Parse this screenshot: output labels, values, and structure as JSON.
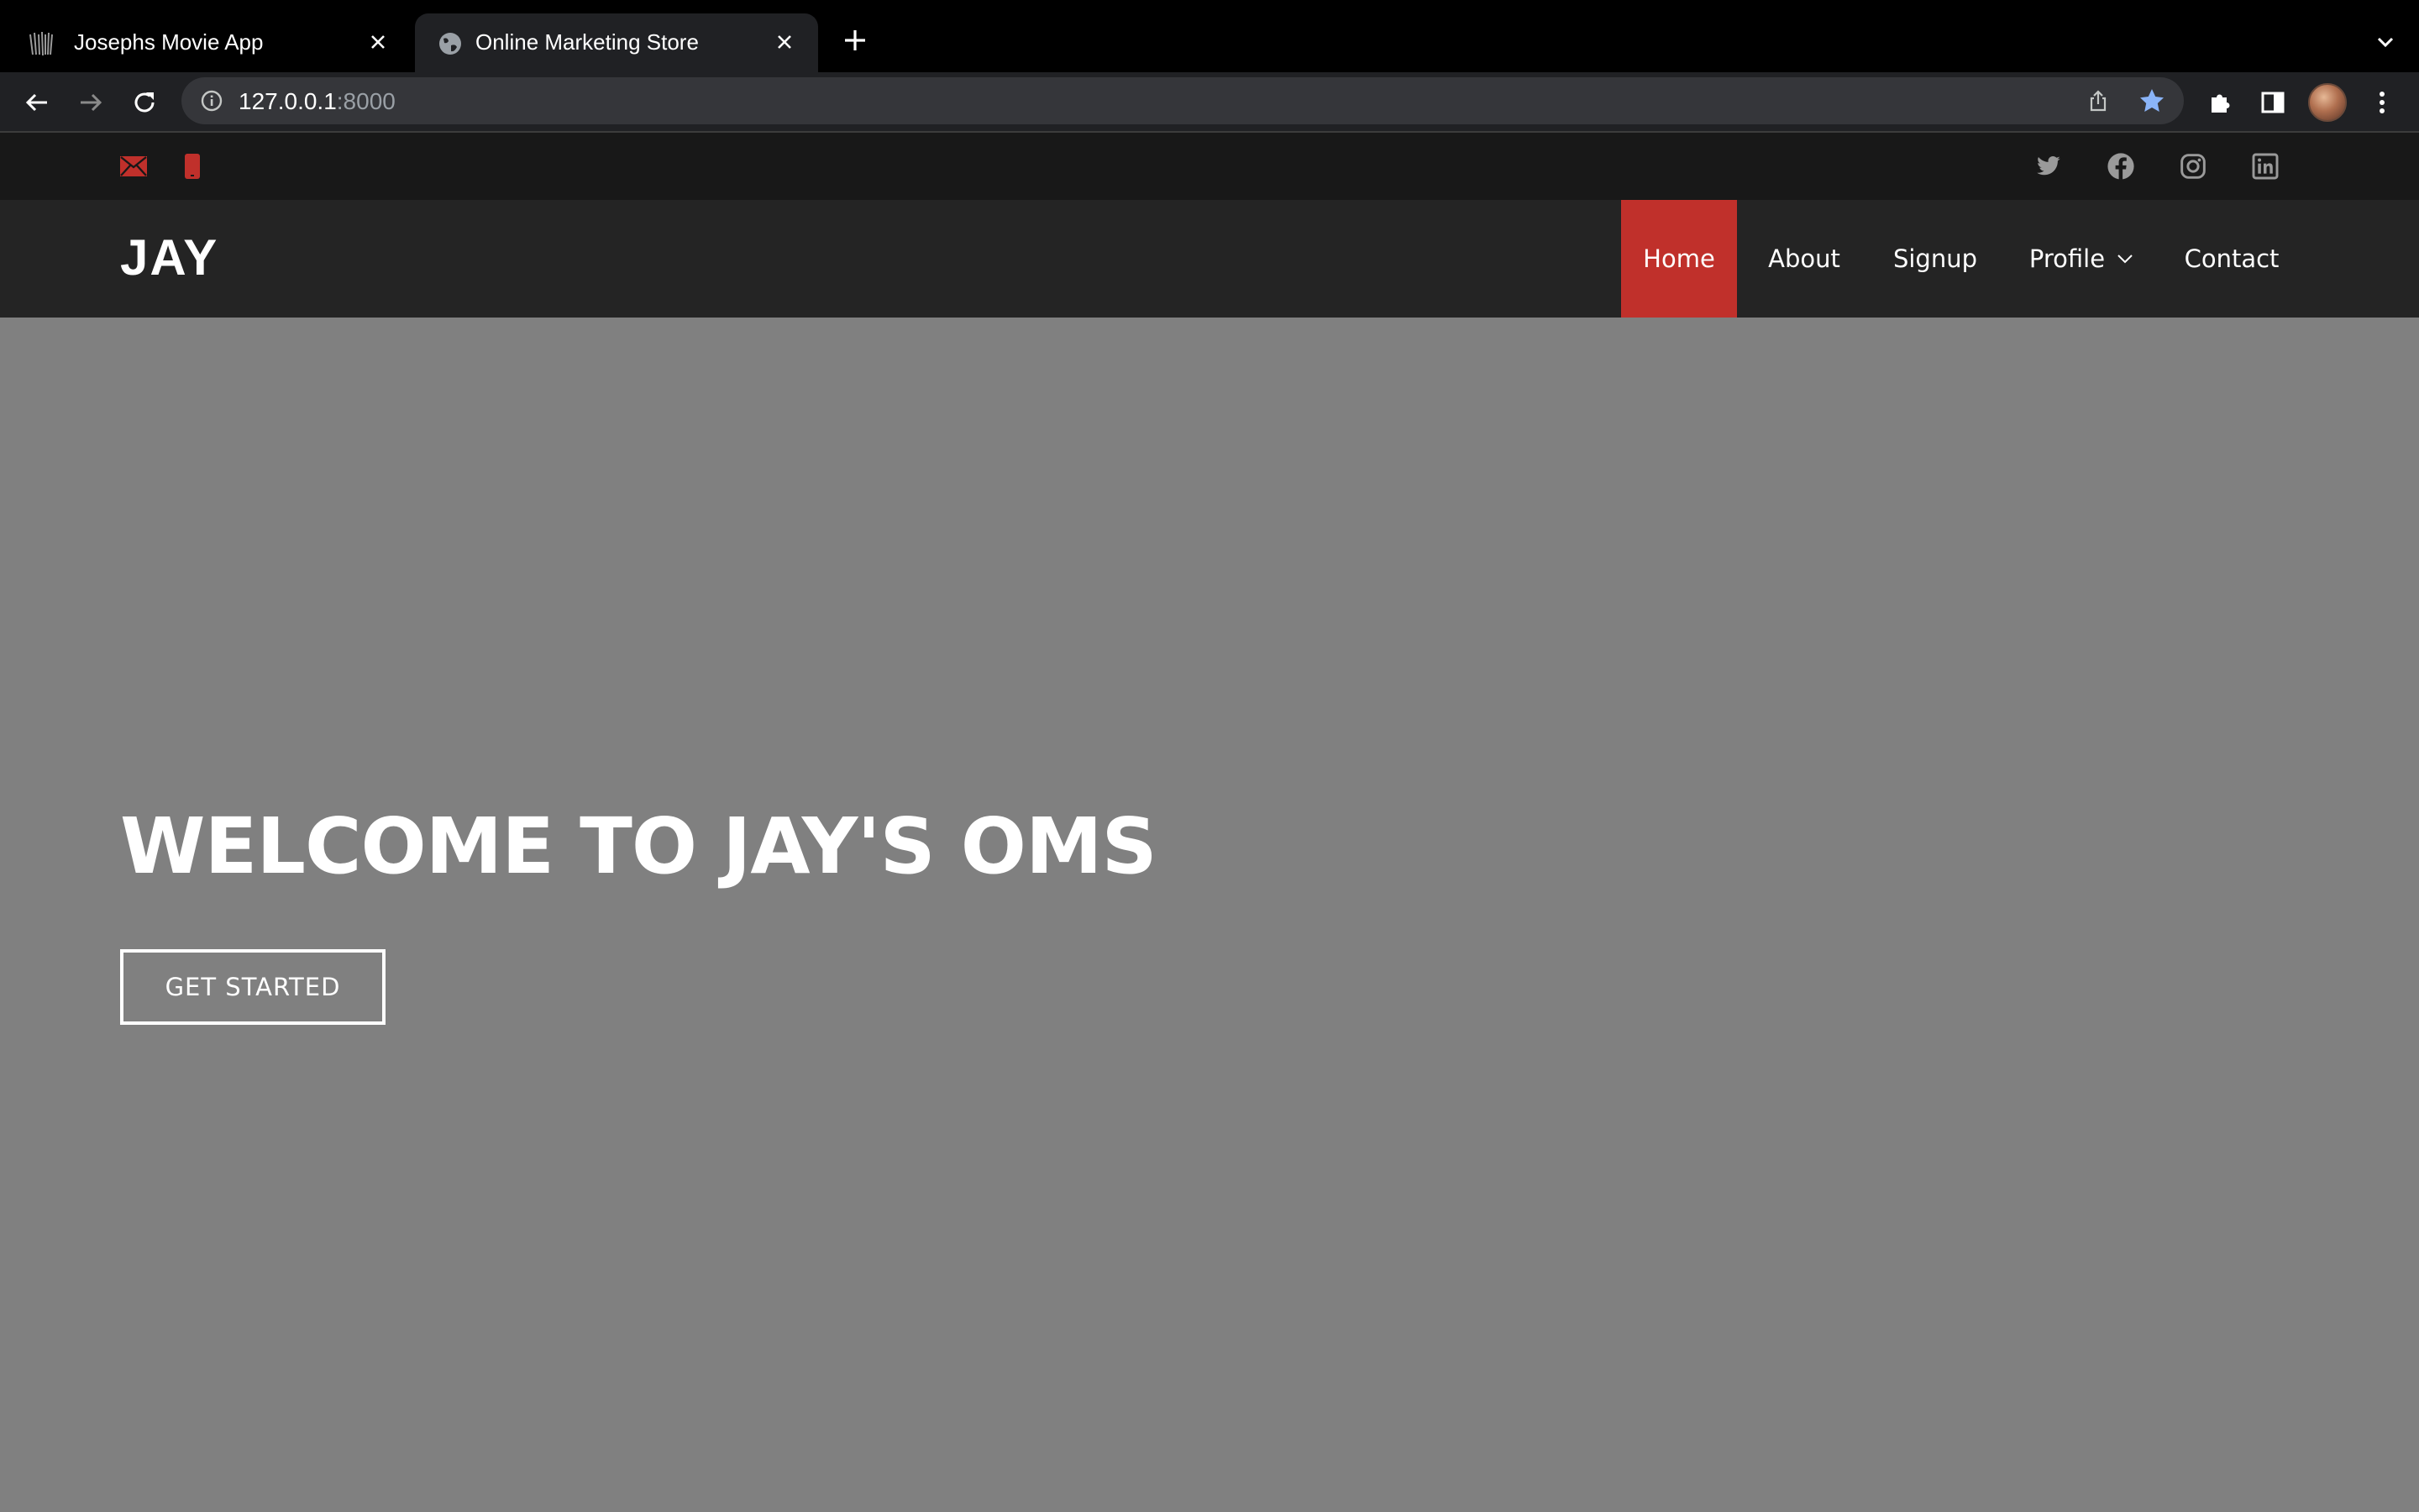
{
  "browser": {
    "tabs": [
      {
        "title": "Josephs Movie App",
        "active": false,
        "favicon": "movie-app-favicon-icon"
      },
      {
        "title": "Online Marketing Store",
        "active": true,
        "favicon": "globe-icon"
      }
    ],
    "url": {
      "host": "127.0.0.1",
      "port": ":8000"
    },
    "bookmarked": true,
    "colors": {
      "tabstrip": "#000000",
      "toolbar": "#202124",
      "omnibox": "#35363a",
      "star": "#8ab4f8"
    }
  },
  "site": {
    "topbar": {
      "contact_icons": [
        "envelope-icon",
        "phone-icon"
      ],
      "social_icons": [
        "twitter-icon",
        "facebook-icon",
        "instagram-icon",
        "linkedin-icon"
      ]
    },
    "logo": "JAY",
    "nav": [
      {
        "label": "Home",
        "active": true
      },
      {
        "label": "About",
        "active": false
      },
      {
        "label": "Signup",
        "active": false
      },
      {
        "label": "Profile",
        "active": false,
        "dropdown": true
      },
      {
        "label": "Contact",
        "active": false
      }
    ],
    "hero": {
      "title": "WELCOME TO JAY'S OMS",
      "cta": "GET STARTED"
    },
    "colors": {
      "accent": "#c0302b",
      "topbar": "#181818",
      "header": "#242424",
      "hero": "#808080"
    }
  }
}
